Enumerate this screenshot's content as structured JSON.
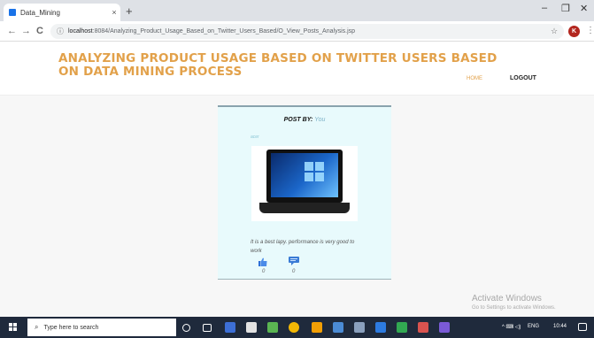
{
  "browser": {
    "tab_title": "Data_Mining",
    "tab_close": "×",
    "new_tab": "+",
    "url_host": "localhost",
    "url_path": ":8084/Analyzing_Product_Usage_Based_on_Twitter_Users_Based/O_View_Posts_Analysis.jsp",
    "win_minimize": "–",
    "win_maximize": "❐",
    "win_close": "✕",
    "back": "←",
    "forward": "→",
    "reload": "C",
    "info": "ⓘ",
    "star": "☆",
    "avatar_letter": "K",
    "menu": "⋮"
  },
  "site": {
    "title": "ANALYZING PRODUCT USAGE BASED ON TWITTER USERS BASED ON DATA MINING PROCESS",
    "nav_home": "HOME",
    "nav_logout": "LOGOUT"
  },
  "post": {
    "by_label": "POST BY:",
    "by_user": "You",
    "name": "acer",
    "text": "It is a best lapy. performance is very good to work",
    "likes": "0",
    "dislikes": "0",
    "colors": {
      "card_bg": "#e8fafc",
      "accent": "#e2a14a"
    }
  },
  "watermark": {
    "title": "Activate Windows",
    "subtitle": "Go to Settings to activate Windows."
  },
  "taskbar": {
    "search_placeholder": "Type here to search",
    "lang": "ENG",
    "time": "10:44"
  }
}
